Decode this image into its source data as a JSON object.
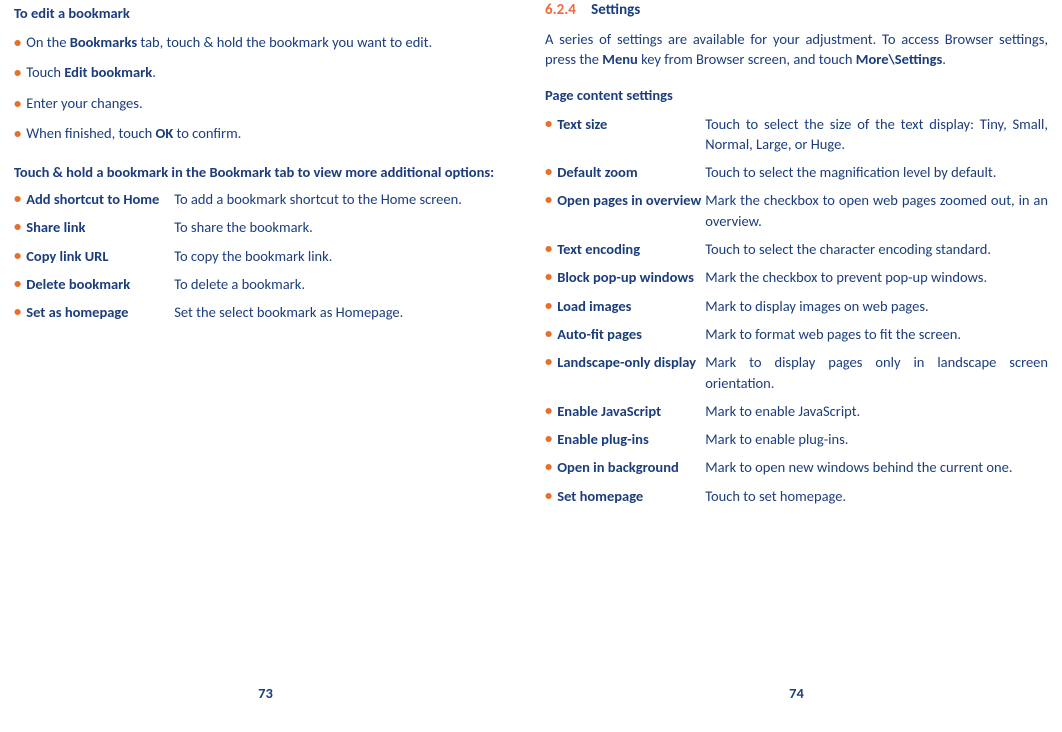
{
  "left": {
    "editHeading": "To edit a bookmark",
    "bullets": [
      {
        "prefix": "On the ",
        "bold": "Bookmarks",
        "suffix": " tab, touch & hold the bookmark you want to edit."
      },
      {
        "prefix": "Touch ",
        "bold": "Edit bookmark",
        "suffix": "."
      },
      {
        "prefix": "Enter your changes.",
        "bold": "",
        "suffix": ""
      },
      {
        "prefix": "When finished, touch ",
        "bold": "OK",
        "suffix": " to confirm."
      }
    ],
    "touchHoldHeading": "Touch & hold a bookmark in the Bookmark tab to view more additional options:",
    "options": [
      {
        "label": "Add shortcut to Home",
        "desc": "To add a bookmark shortcut to the Home screen."
      },
      {
        "label": "Share link",
        "desc": "To share the bookmark."
      },
      {
        "label": "Copy link URL",
        "desc": "To copy the bookmark link."
      },
      {
        "label": "Delete bookmark",
        "desc": "To delete a bookmark."
      },
      {
        "label": "Set as homepage",
        "desc": "Set the select bookmark as Homepage."
      }
    ],
    "pageNum": "73"
  },
  "right": {
    "sectionNum": "6.2.4",
    "sectionTitle": "Settings",
    "intro_pre": "A series of settings are available for your adjustment. To access Browser settings, press the ",
    "intro_bold1": "Menu",
    "intro_mid": " key from Browser screen, and touch ",
    "intro_bold2": "More\\Settings",
    "intro_post": ".",
    "subhead": "Page content settings",
    "options": [
      {
        "label": "Text size",
        "desc": "Touch to select the size of the text display: Tiny, Small, Normal, Large, or Huge."
      },
      {
        "label": "Default zoom",
        "desc": "Touch to select the magnification level by default."
      },
      {
        "label": "Open pages in overview",
        "desc": "Mark the checkbox to open web pages zoomed out, in an overview."
      },
      {
        "label": "Text encoding",
        "desc": "Touch to select the character encoding standard."
      },
      {
        "label": "Block pop-up windows",
        "desc": "Mark the checkbox to prevent pop-up windows."
      },
      {
        "label": "Load images",
        "desc": "Mark to display images on web pages."
      },
      {
        "label": "Auto-fit pages",
        "desc": "Mark to format web pages to fit the screen."
      },
      {
        "label": "Landscape-only display",
        "desc": "Mark to display pages only in landscape screen orientation."
      },
      {
        "label": "Enable JavaScript",
        "desc": "Mark to enable JavaScript."
      },
      {
        "label": "Enable plug-ins",
        "desc": "Mark to enable plug-ins."
      },
      {
        "label": "Open in background",
        "desc": "Mark to open new windows behind the current one."
      },
      {
        "label": "Set homepage",
        "desc": "Touch to set homepage."
      }
    ],
    "pageNum": "74"
  }
}
